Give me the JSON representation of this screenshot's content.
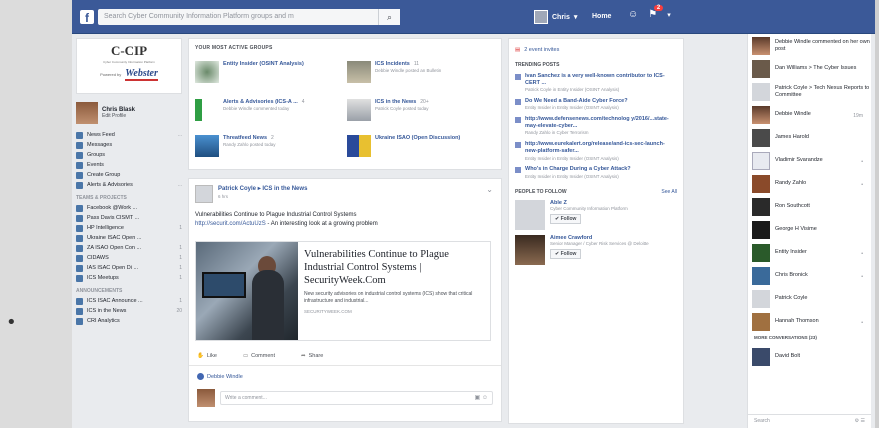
{
  "topbar": {
    "search_placeholder": "Search Cyber Community Information Platform groups and m",
    "user_name": "Chris",
    "home_label": "Home",
    "notification_count": "2"
  },
  "left": {
    "logo_title": "C-CIP",
    "logo_subtitle": "Cyber Community Information Platform",
    "logo_powered": "Powered by",
    "logo_brand": "Webster",
    "profile_name": "Chris Blask",
    "profile_edit": "Edit Profile",
    "nav": [
      {
        "label": "News Feed",
        "count": "..."
      },
      {
        "label": "Messages",
        "count": ""
      },
      {
        "label": "Groups",
        "count": ""
      },
      {
        "label": "Events",
        "count": ""
      },
      {
        "label": "Create Group",
        "count": ""
      },
      {
        "label": "Alerts & Advisories",
        "count": "..."
      }
    ],
    "section_teams": "TEAMS & PROJECTS",
    "teams": [
      {
        "label": "Facebook @Work ...",
        "count": ""
      },
      {
        "label": "Pass Davis CISMT ...",
        "count": ""
      },
      {
        "label": "HP Intelligence",
        "count": "1"
      },
      {
        "label": "Ukraine ISAC Open ...",
        "count": ""
      },
      {
        "label": "ZA ISAO Open Con ...",
        "count": "1"
      },
      {
        "label": "CIDAWS",
        "count": "1"
      },
      {
        "label": "IAS ISAC Open Di ...",
        "count": "1"
      },
      {
        "label": "ICS Meetups",
        "count": "1"
      }
    ],
    "section_announcements": "ANNOUNCEMENTS",
    "announcements": [
      {
        "label": "ICS ISAC Announce ...",
        "count": "1"
      },
      {
        "label": "ICS in the News",
        "count": "20"
      },
      {
        "label": "CRI Analytics",
        "count": ""
      }
    ]
  },
  "groups": {
    "heading": "YOUR MOST ACTIVE GROUPS",
    "items": [
      {
        "name": "Entity Insider (OSINT Analysis)",
        "count": "",
        "meta": ""
      },
      {
        "name": "ICS Incidents",
        "count": "11",
        "meta": "Debbie Windle posted an Bulletin"
      },
      {
        "name": "Alerts & Advisories (ICS-A ...",
        "count": "4",
        "meta": "Debbie Windle commented today"
      },
      {
        "name": "ICS in the News",
        "count": "20+",
        "meta": "Patrick Coyle posted today"
      },
      {
        "name": "Threatfeed News",
        "count": "2",
        "meta": "Randy Zahlo posted today"
      },
      {
        "name": "Ukraine ISAO (Open Discussion)",
        "count": "",
        "meta": ""
      }
    ]
  },
  "post": {
    "author": "Patrick Coyle",
    "group": "ICS in the News",
    "time": "6 hrs",
    "text": "Vulnerabilities Continue to Plague Industrial Control Systems",
    "link_inline": "http://securit.com/ActuUzS",
    "text_after": "- An interesting look at a growing problem",
    "preview_title": "Vulnerabilities Continue to Plague Industrial Control Systems | SecurityWeek.Com",
    "preview_desc": "New security advisories on industrial control systems (ICS) show that critical infrastructure and industrial...",
    "preview_domain": "SECURITYWEEK.COM",
    "like_label": "Like",
    "comment_label": "Comment",
    "share_label": "Share",
    "liker": "Debbie Windle",
    "comment_placeholder": "Write a comment..."
  },
  "right": {
    "events": "2 event invites",
    "trending_head": "TRENDING POSTS",
    "trending": [
      {
        "title": "Ivan Sanchez is a very well-known contributor to ICS-CERT ...",
        "meta": "Patrick Coyle in Entity Insider (OSINT Analysis)"
      },
      {
        "title": "Do We Need a Band-Aide Cyber Force?",
        "meta": "Entity Insider in Entity Insider (OSINT Analysis)"
      },
      {
        "title": "http://www.defensenews.com/technolog y/2016/...state-may-elevate-cyber...",
        "meta": "Randy Zahlo in Cyber Terrorism"
      },
      {
        "title": "http://www.eurekalert.org/release/and-ics-sec-launch-new-platform-safer...",
        "meta": "Entity Insider in Entity Insider (OSINT Analysis)"
      },
      {
        "title": "Who's in Charge During a Cyber Attack?",
        "meta": "Entity Insider in Entity Insider (OSINT Analysis)"
      }
    ],
    "pymk_head": "PEOPLE TO FOLLOW",
    "pymk_seeall": "See All",
    "pymk": [
      {
        "name": "Able Z",
        "role": "Cyber Community Information Platform",
        "follow": "Follow"
      },
      {
        "name": "Aimee Crawford",
        "role": "Senior Manager / Cyber Risk Services @ Deloitte",
        "follow": "Follow"
      }
    ]
  },
  "chat": {
    "items": [
      {
        "name": "Debbie Windle commented on her own post",
        "dot": ""
      },
      {
        "name": "Dan Williams > The Cyber Issues",
        "dot": ""
      },
      {
        "name": "Patrick Coyle > Tech Nexus Reports to Committee",
        "dot": ""
      },
      {
        "name": "Debbie Windle",
        "dot": "19m"
      },
      {
        "name": "James Harold",
        "dot": ""
      },
      {
        "name": "Vladimir Svarandze",
        "dot": "•"
      },
      {
        "name": "Randy Zahlo",
        "dot": "•"
      },
      {
        "name": "Ron Southcott",
        "dot": ""
      },
      {
        "name": "George H Visime",
        "dot": ""
      },
      {
        "name": "Entity Insider",
        "dot": "•"
      },
      {
        "name": "Chris Bronick",
        "dot": "•"
      },
      {
        "name": "Patrick Coyle",
        "dot": ""
      },
      {
        "name": "Hannah Thomson",
        "dot": "•"
      }
    ],
    "section": "MORE CONVERSATIONS (23)",
    "last": "David Bolt",
    "search": "Search"
  }
}
